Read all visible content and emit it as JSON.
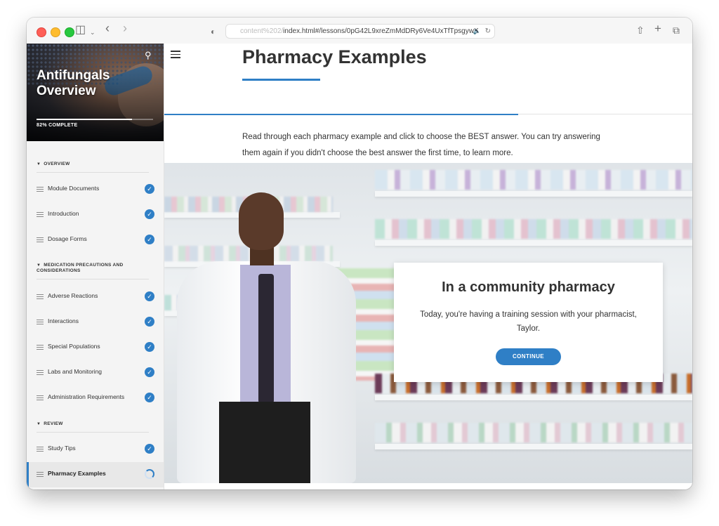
{
  "browser": {
    "url_faded": "content%202/",
    "url_main": "index.html#/lessons/0pG42L9xreZmMdDRy6Ve4UxTfTpsgywK",
    "icons": [
      "sidebar-toggle-icon",
      "chevron-down-icon",
      "back-icon",
      "forward-icon",
      "shield-icon",
      "speaker-icon",
      "reload-icon",
      "share-icon",
      "new-tab-icon",
      "tabs-overview-icon"
    ]
  },
  "sidebar": {
    "course_title": "Antifungals Overview",
    "progress_text": "82% COMPLETE",
    "progress_value": 0.82,
    "sections": [
      {
        "title": "OVERVIEW",
        "items": [
          {
            "label": "Module Documents",
            "status": "complete"
          },
          {
            "label": "Introduction",
            "status": "complete"
          },
          {
            "label": "Dosage Forms",
            "status": "complete"
          }
        ]
      },
      {
        "title": "MEDICATION PRECAUTIONS AND CONSIDERATIONS",
        "items": [
          {
            "label": "Adverse Reactions",
            "status": "complete"
          },
          {
            "label": "Interactions",
            "status": "complete"
          },
          {
            "label": "Special Populations",
            "status": "complete"
          },
          {
            "label": "Labs and Monitoring",
            "status": "complete"
          },
          {
            "label": "Administration Requirements",
            "status": "complete"
          }
        ]
      },
      {
        "title": "REVIEW",
        "items": [
          {
            "label": "Study Tips",
            "status": "complete"
          },
          {
            "label": "Pharmacy Examples",
            "status": "in-progress"
          }
        ]
      }
    ]
  },
  "lesson": {
    "title": "Pharmacy Examples",
    "intro": "Read through each pharmacy example and click to choose the BEST answer.  You can try answering them again if you didn't choose the best answer the first time, to learn more."
  },
  "card": {
    "title": "In a community pharmacy",
    "text": "Today, you're having a training session with your pharmacist, Taylor.",
    "button": "CONTINUE"
  },
  "colors": {
    "accent": "#2f7fc6"
  }
}
